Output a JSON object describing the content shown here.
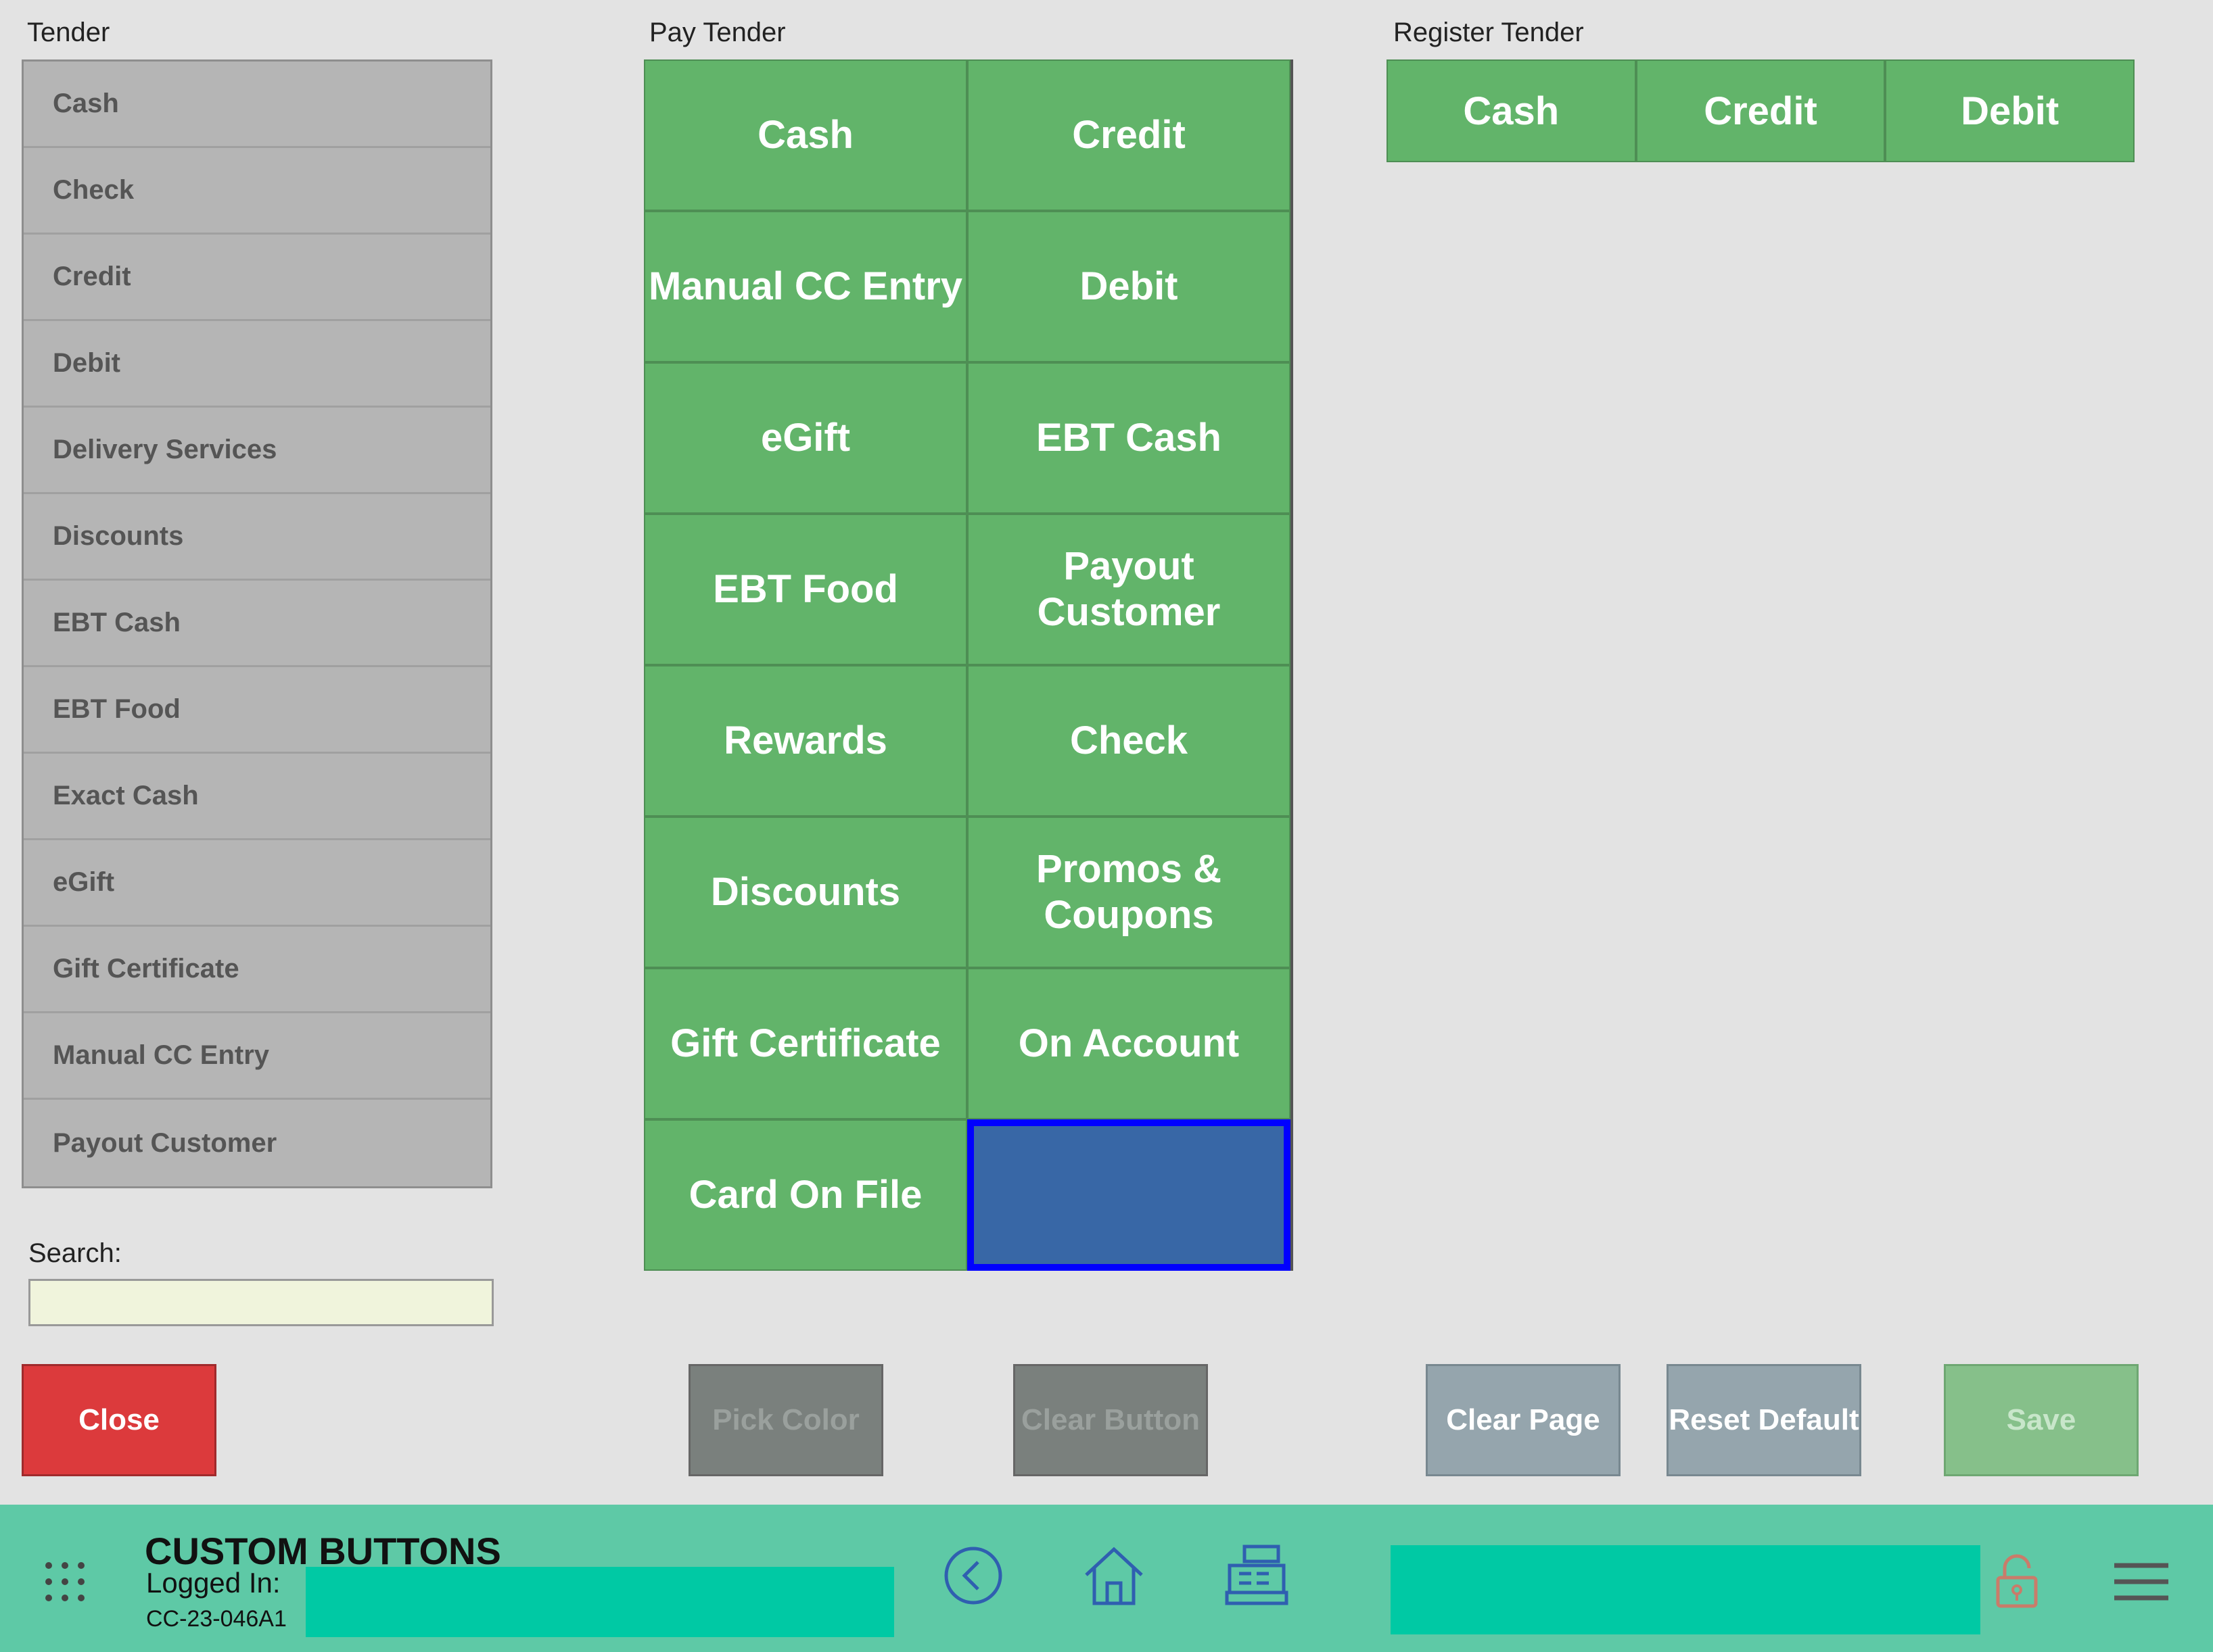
{
  "tender": {
    "title": "Tender",
    "items": [
      "Cash",
      "Check",
      "Credit",
      "Debit",
      "Delivery Services",
      "Discounts",
      "EBT Cash",
      "EBT Food",
      "Exact Cash",
      "eGift",
      "Gift Certificate",
      "Manual CC Entry",
      "Payout Customer"
    ]
  },
  "search": {
    "label": "Search:",
    "value": ""
  },
  "pay_tender": {
    "title": "Pay Tender",
    "buttons": [
      "Cash",
      "Credit",
      "Manual CC Entry",
      "Debit",
      "eGift",
      "EBT Cash",
      "EBT Food",
      "Payout Customer",
      "Rewards",
      "Check",
      "Discounts",
      "Promos & Coupons",
      "Gift Certificate",
      "On Account",
      "Card On File",
      ""
    ]
  },
  "register_tender": {
    "title": "Register Tender",
    "buttons": [
      "Cash",
      "Credit",
      "Debit"
    ]
  },
  "actions": {
    "close": "Close",
    "pick_color": "Pick Color",
    "clear_button": "Clear Button",
    "clear_page": "Clear Page",
    "reset_default": "Reset Default",
    "save": "Save"
  },
  "footer": {
    "title": "CUSTOM BUTTONS",
    "logged_in_label": "Logged In:",
    "device_id": "CC-23-046A1"
  },
  "colors": {
    "button_green": "#62b46a",
    "selected_blue": "#3867a6",
    "close_red": "#dc3a3c",
    "footer_teal": "#5ec9a6"
  }
}
